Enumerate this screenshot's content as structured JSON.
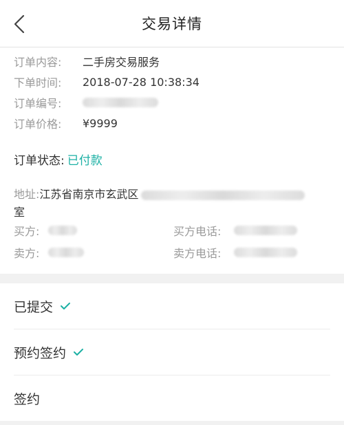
{
  "header": {
    "title": "交易详情"
  },
  "order": {
    "content_label": "订单内容:",
    "content_value": "二手房交易服务",
    "time_label": "下单时间:",
    "time_value": "2018-07-28 10:38:34",
    "number_label": "订单编号:",
    "price_label": "订单价格:",
    "price_value": "¥9999",
    "status_label": "订单状态:",
    "status_value": "已付款"
  },
  "address": {
    "label": "地址:",
    "value_visible": "江苏省南京市玄武区",
    "value_tail": "室"
  },
  "parties": {
    "buyer_label": "买方:",
    "buyer_phone_label": "买方电话:",
    "seller_label": "卖方:",
    "seller_phone_label": "卖方电话:"
  },
  "steps": [
    {
      "label": "已提交",
      "done": true
    },
    {
      "label": "预约签约",
      "done": true
    },
    {
      "label": "签约",
      "done": false
    }
  ],
  "colors": {
    "accent": "#1bb0a4",
    "label": "#9a9a9a",
    "separator": "#f1f1f1"
  }
}
